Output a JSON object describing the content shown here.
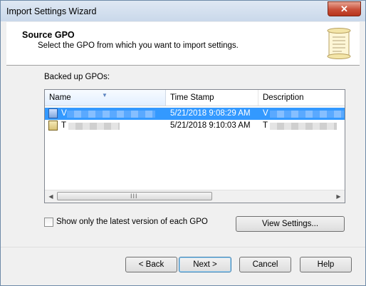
{
  "window": {
    "title": "Import Settings Wizard",
    "close_glyph": "✕"
  },
  "header": {
    "title": "Source GPO",
    "subtitle": "Select the GPO from which you want to import settings.",
    "icon": "scroll-icon"
  },
  "list": {
    "label": "Backed up GPOs:",
    "columns": [
      "Name",
      "Time Stamp",
      "Description"
    ],
    "sort_indicator": "▼",
    "rows": [
      {
        "name": "V",
        "time": "5/21/2018 9:08:29 AM",
        "desc": "V",
        "selected": true
      },
      {
        "name": "T",
        "time": "5/21/2018 9:10:03 AM",
        "desc": "T",
        "selected": false
      }
    ],
    "scroll_left": "◀",
    "scroll_right": "▶",
    "scroll_grip": "III"
  },
  "options": {
    "latest_only_label": "Show only the latest version of each GPO"
  },
  "buttons": {
    "view_settings": "View Settings...",
    "back": "< Back",
    "next": "Next >",
    "cancel": "Cancel",
    "help": "Help"
  }
}
